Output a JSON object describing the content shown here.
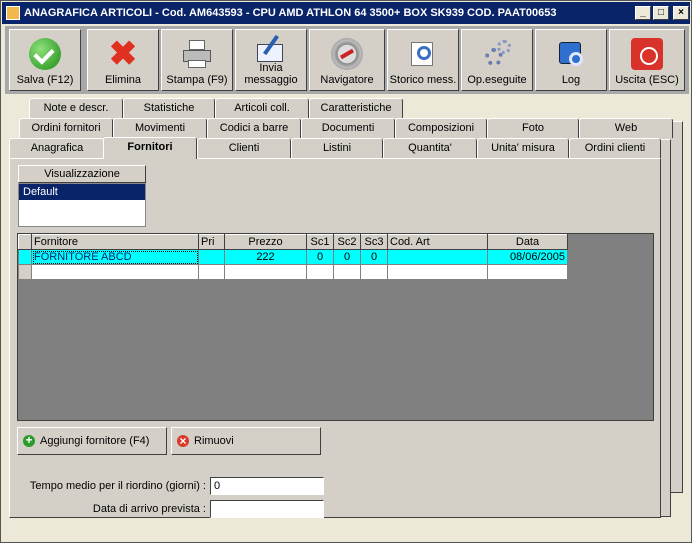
{
  "window": {
    "title": "ANAGRAFICA ARTICOLI - Cod. AM643593 - CPU AMD ATHLON 64 3500+ BOX SK939 COD. PAAT00653",
    "controls": {
      "minimize": "_",
      "maximize": "□",
      "close": "×"
    }
  },
  "toolbar": [
    {
      "label": "Salva (F12)",
      "icon": "check-icon"
    },
    {
      "label": "Elimina",
      "icon": "delete-x-icon"
    },
    {
      "label": "Stampa (F9)",
      "icon": "printer-icon"
    },
    {
      "label_line1": "Invia",
      "label_line2": "messaggio",
      "icon": "send-message-icon"
    },
    {
      "label": "Navigatore",
      "icon": "compass-icon"
    },
    {
      "label": "Storico mess.",
      "icon": "message-history-icon"
    },
    {
      "label": "Op.eseguite",
      "icon": "gears-icon"
    },
    {
      "label": "Log",
      "icon": "log-icon"
    },
    {
      "label": "Uscita (ESC)",
      "icon": "exit-icon"
    }
  ],
  "tabs_row1": [
    "Note e descr.",
    "Statistiche",
    "Articoli coll.",
    "Caratteristiche"
  ],
  "tabs_row2": [
    "Ordini fornitori",
    "Movimenti",
    "Codici a barre",
    "Documenti",
    "Composizioni",
    "Foto",
    "Web"
  ],
  "tabs_row3": [
    "Anagrafica",
    "Fornitori",
    "Clienti",
    "Listini",
    "Quantita'",
    "Unita' misura",
    "Ordini clienti"
  ],
  "active_tab": "Fornitori",
  "visualizzazione": {
    "header": "Visualizzazione",
    "items": [
      "Default"
    ]
  },
  "grid": {
    "columns": [
      "Fornitore",
      "Pri",
      "Prezzo",
      "Sc1",
      "Sc2",
      "Sc3",
      "Cod. Art",
      "Data"
    ],
    "rows": [
      {
        "fornitore": "FORNITORE ABCD",
        "pri": "",
        "prezzo": "222",
        "sc1": "0",
        "sc2": "0",
        "sc3": "0",
        "cod_art": "",
        "data": "08/06/2005"
      }
    ]
  },
  "buttons": {
    "add": "Aggiungi fornitore (F4)",
    "remove": "Rimuovi"
  },
  "fields": {
    "tempo_label": "Tempo medio per il riordino (giorni) :",
    "tempo_value": "0",
    "data_arrivo_label": "Data di arrivo prevista :",
    "data_arrivo_value": ""
  },
  "colors": {
    "titlebar": "#0a246a",
    "selected_row": "#00ffff",
    "grid_background": "#808080"
  }
}
